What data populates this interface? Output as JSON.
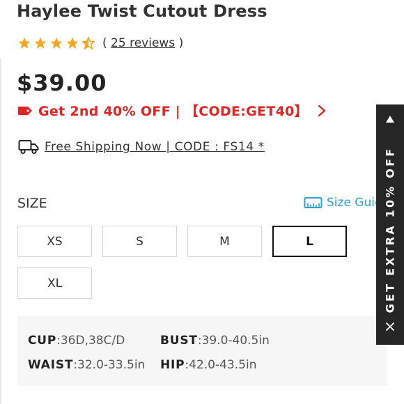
{
  "product": {
    "title": "Haylee Twist Cutout Dress",
    "rating": 4.5,
    "reviews_open": "(",
    "reviews_link": "25 reviews",
    "reviews_close": ")",
    "price": "$39.00"
  },
  "promo": {
    "text": "Get 2nd 40% OFF | 【CODE:GET40】",
    "icon": "tag-icon",
    "color": "#e02323"
  },
  "shipping": {
    "icon": "truck-icon",
    "text": "Free Shipping Now | CODE : FS14 *"
  },
  "size": {
    "label": "SIZE",
    "guide_label": "Size Guide",
    "guide_icon": "ruler-icon",
    "options": [
      "XS",
      "S",
      "M",
      "L",
      "XL"
    ],
    "selected": "L"
  },
  "measurements": {
    "cup_label": "CUP",
    "cup_value": ":36D,38C/D",
    "bust_label": "BUST",
    "bust_value": ":39.0-40.5in",
    "waist_label": "WAIST",
    "waist_value": ":32.0-33.5in",
    "hip_label": "HIP",
    "hip_value": ":42.0-43.5in"
  },
  "side_tab": {
    "text": "GET EXTRA 10% OFF",
    "background": "#262626"
  },
  "colors": {
    "star": "#f5a623",
    "link_blue": "#2f9fd4"
  }
}
